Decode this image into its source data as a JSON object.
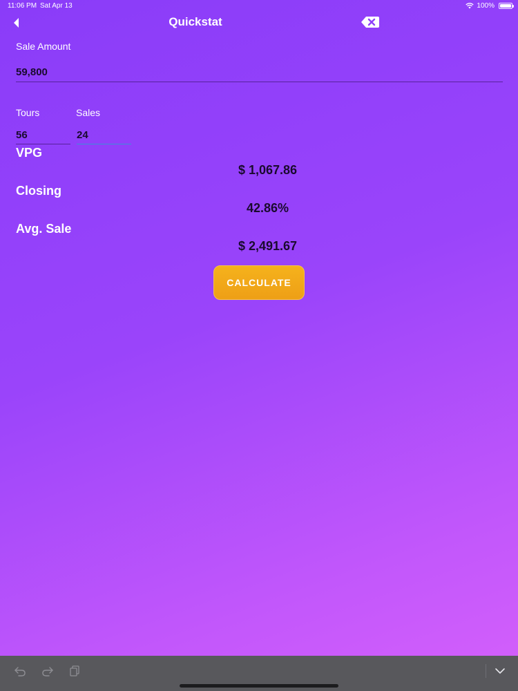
{
  "status_bar": {
    "time": "11:06 PM",
    "date": "Sat Apr 13",
    "battery": "100%",
    "icons": [
      "wifi-icon",
      "battery-icon"
    ]
  },
  "nav": {
    "title": "Quickstat",
    "back_icon": "chevron-left-icon",
    "clear_icon": "backspace-clear-icon"
  },
  "form": {
    "sale_amount": {
      "label": "Sale Amount",
      "value": "59,800"
    },
    "tours": {
      "label": "Tours",
      "value": "56"
    },
    "sales": {
      "label": "Sales",
      "value": "24"
    }
  },
  "results": {
    "vpg": {
      "label": "VPG",
      "value": "$ 1,067.86"
    },
    "closing": {
      "label": "Closing",
      "value": "42.86%"
    },
    "avg_sale": {
      "label": "Avg. Sale",
      "value": "$ 2,491.67"
    }
  },
  "actions": {
    "calculate_label": "CALCULATE"
  },
  "keyboard_bar": {
    "icons": [
      "undo-icon",
      "redo-icon",
      "paste-icon",
      "keyboard-dismiss-icon"
    ]
  },
  "colors": {
    "background_start": "#8a3cf9",
    "background_end": "#d560fb",
    "button": "#f2a81a",
    "value_text": "#1a0a2e",
    "active_underline": "#3a8fd8"
  }
}
